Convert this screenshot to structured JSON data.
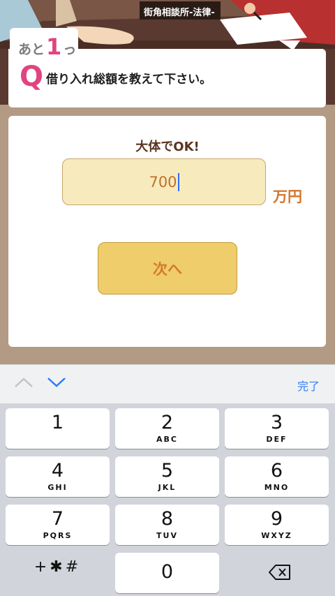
{
  "scene": {
    "sign_text": "街角相談所-法律-"
  },
  "question": {
    "remaining_pre": "あと",
    "remaining_num": "1",
    "remaining_post": "っ",
    "q_mark": "Q",
    "text": "借り入れ総額を教えて下さい。"
  },
  "answer": {
    "hint": "大体でOK!",
    "value": "700",
    "unit": "万円",
    "next_label": "次へ"
  },
  "accessory": {
    "done_label": "完了",
    "prev_icon": "chevron-up-icon",
    "next_icon": "chevron-down-icon"
  },
  "keypad": {
    "keys": [
      {
        "digit": "1",
        "letters": ""
      },
      {
        "digit": "2",
        "letters": "ABC"
      },
      {
        "digit": "3",
        "letters": "DEF"
      },
      {
        "digit": "4",
        "letters": "GHI"
      },
      {
        "digit": "5",
        "letters": "JKL"
      },
      {
        "digit": "6",
        "letters": "MNO"
      },
      {
        "digit": "7",
        "letters": "PQRS"
      },
      {
        "digit": "8",
        "letters": "TUV"
      },
      {
        "digit": "9",
        "letters": "WXYZ"
      }
    ],
    "symbols_label": "+✱#",
    "zero": "0",
    "delete_icon": "backspace-icon"
  },
  "colors": {
    "accent_pink": "#e0457f",
    "input_bg": "#f7ebbd",
    "button_bg": "#eecd6a",
    "link_blue": "#2f7cf6"
  }
}
